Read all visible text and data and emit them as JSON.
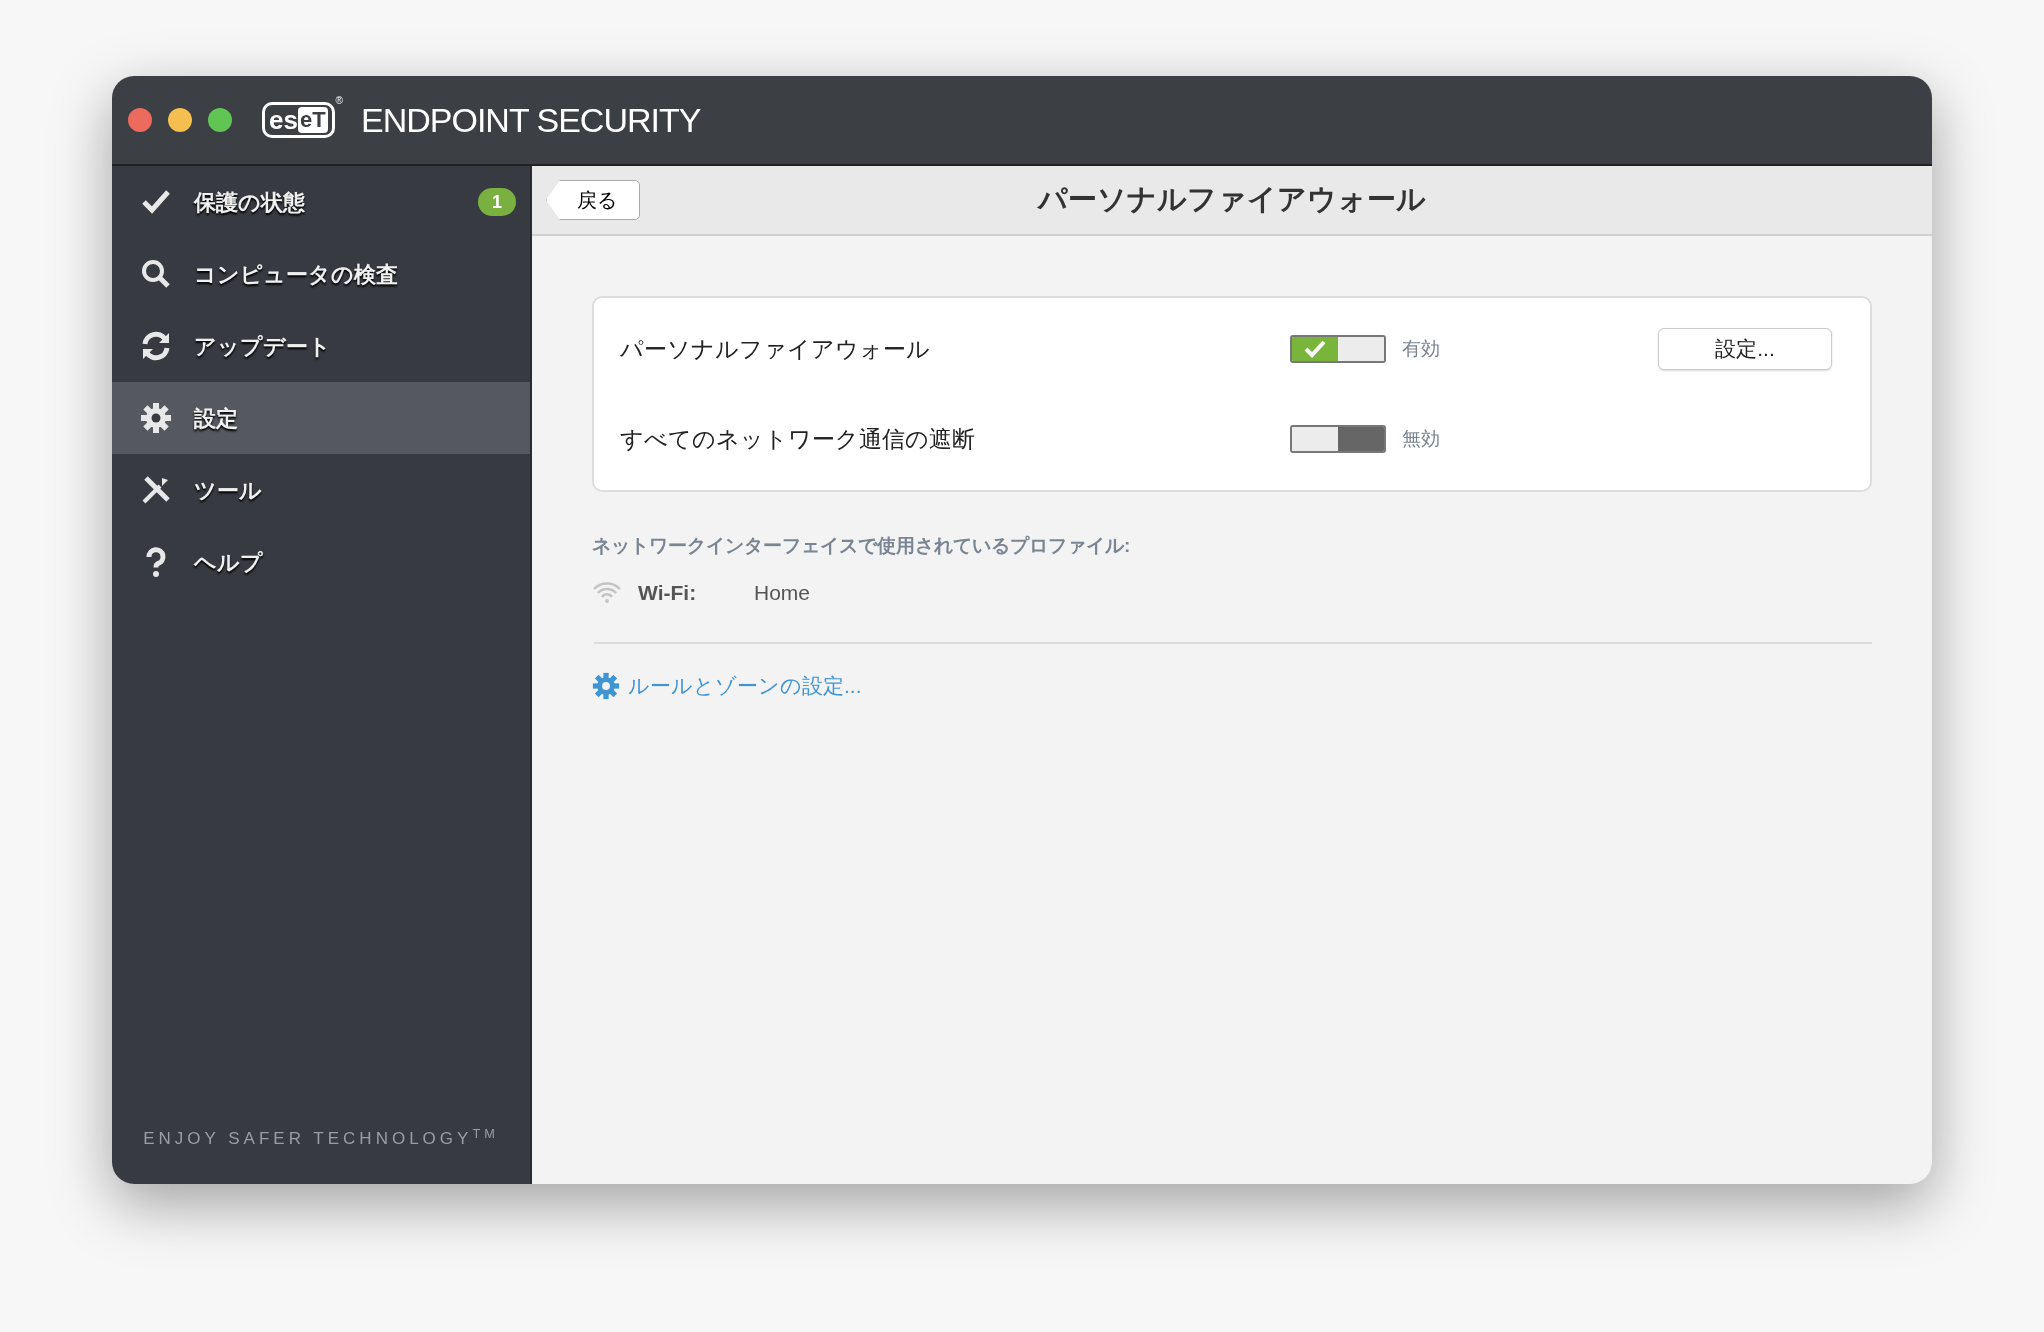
{
  "window": {
    "logo": {
      "part_1": "es",
      "part_2": "eT",
      "mark": "®"
    },
    "title": "ENDPOINT SECURITY"
  },
  "sidebar": {
    "items": [
      {
        "label": "保護の状態",
        "selected": false,
        "badge": "1"
      },
      {
        "label": "コンピュータの検査",
        "selected": false
      },
      {
        "label": "アップデート",
        "selected": false
      },
      {
        "label": "設定",
        "selected": true
      },
      {
        "label": "ツール",
        "selected": false
      },
      {
        "label": "ヘルプ",
        "selected": false
      }
    ],
    "footer": "ENJOY SAFER TECHNOLOGY$^{TM}$"
  },
  "header": {
    "back_button": "戻る",
    "title": "パーソナルファイアウォール"
  },
  "settings": [
    {
      "label": "パーソナルファイアウォール",
      "on": true,
      "status": "有効",
      "button": "設定..."
    },
    {
      "label": "すべてのネットワーク通信の遮断",
      "on": false,
      "status": "無効"
    }
  ],
  "profiles": {
    "heading": "ネットワークインターフェイスで使用されているプロファイル:",
    "rows": [
      {
        "name": "Wi-Fi:",
        "value": "Home"
      }
    ]
  },
  "link": "ルールとゾーンの設定..."
}
